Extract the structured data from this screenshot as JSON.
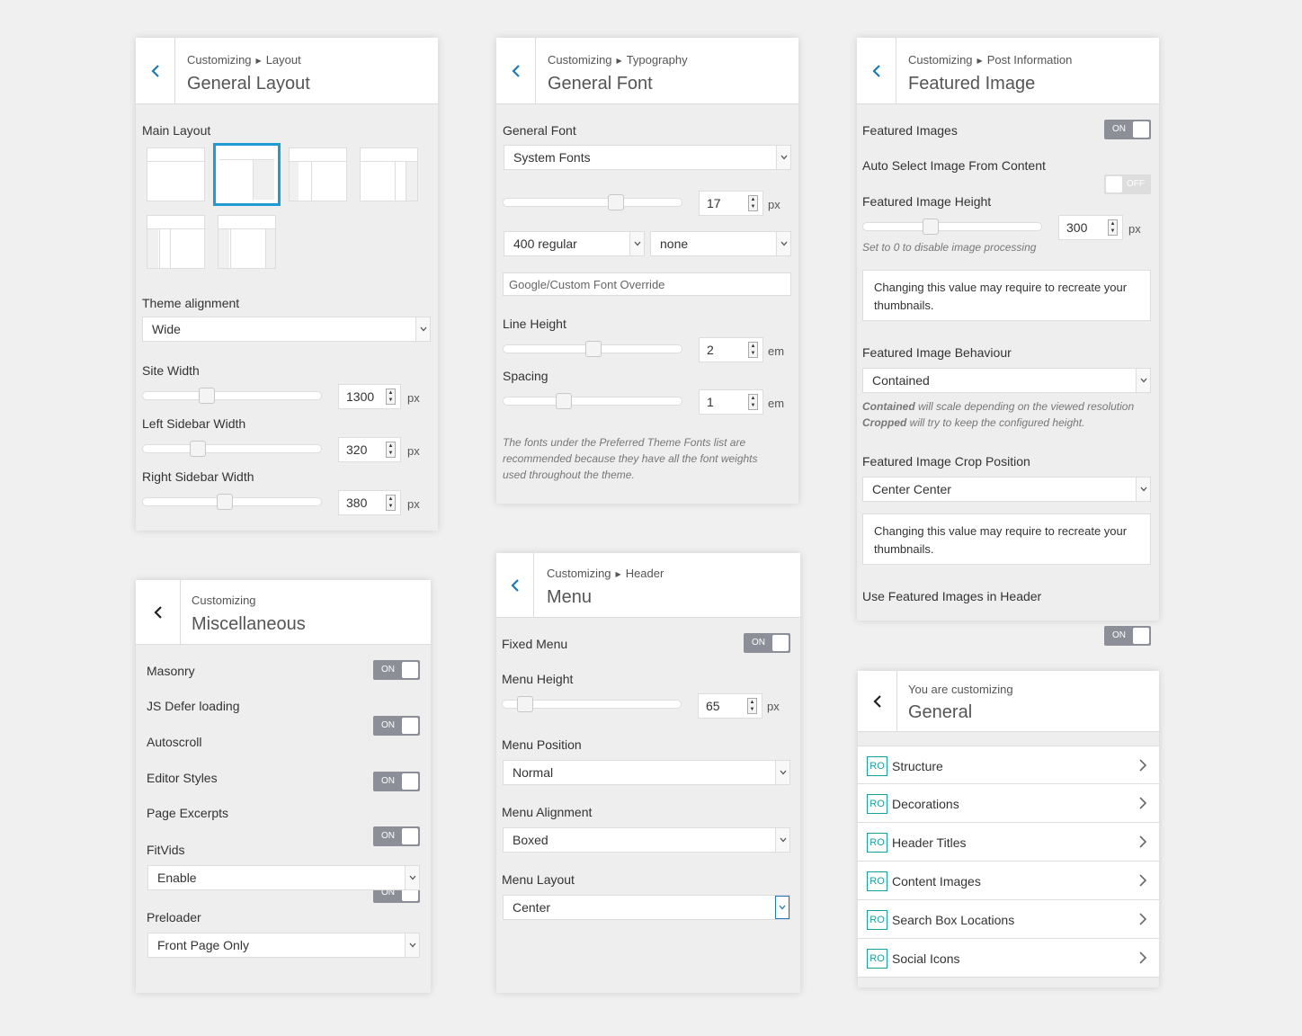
{
  "layout_panel": {
    "crumb_root": "Customizing",
    "crumb_section": "Layout",
    "title": "General Layout",
    "main_layout_label": "Main Layout",
    "theme_alignment_label": "Theme alignment",
    "theme_alignment_value": "Wide",
    "site_width_label": "Site Width",
    "site_width_value": "1300",
    "left_sidebar_label": "Left Sidebar Width",
    "left_sidebar_value": "320",
    "right_sidebar_label": "Right Sidebar Width",
    "right_sidebar_value": "380",
    "unit": "px"
  },
  "typography_panel": {
    "crumb_root": "Customizing",
    "crumb_section": "Typography",
    "title": "General Font",
    "general_font_label": "General Font",
    "general_font_value": "System Fonts",
    "font_size_value": "17",
    "font_size_unit": "px",
    "weight_value": "400 regular",
    "transform_value": "none",
    "override_placeholder": "Google/Custom Font Override",
    "line_height_label": "Line Height",
    "line_height_value": "2",
    "spacing_label": "Spacing",
    "spacing_value": "1",
    "em_unit": "em",
    "note": "The fonts under the Preferred Theme Fonts list are recommended because they have all the font weights used throughout the theme."
  },
  "featured_panel": {
    "crumb_root": "Customizing",
    "crumb_section": "Post Information",
    "title": "Featured Image",
    "featured_images_label": "Featured Images",
    "auto_select_label": "Auto Select Image From Content",
    "height_label": "Featured Image Height",
    "height_value": "300",
    "height_unit": "px",
    "height_note": "Set to 0 to disable image processing",
    "recreate_note_1": "Changing this value may require to recreate your thumbnails.",
    "behaviour_label": "Featured Image Behaviour",
    "behaviour_value": "Contained",
    "behaviour_note_b1": "Contained",
    "behaviour_note_t1": " will scale depending on the viewed resolution",
    "behaviour_note_b2": "Cropped",
    "behaviour_note_t2": " will try to keep the configured height.",
    "crop_label": "Featured Image Crop Position",
    "crop_value": "Center Center",
    "recreate_note_2": "Changing this value may require to recreate your thumbnails.",
    "use_in_header_label": "Use Featured Images in Header"
  },
  "misc_panel": {
    "crumb_root": "Customizing",
    "title": "Miscellaneous",
    "masonry_label": "Masonry",
    "js_defer_label": "JS Defer loading",
    "autoscroll_label": "Autoscroll",
    "editor_styles_label": "Editor Styles",
    "page_excerpts_label": "Page Excerpts",
    "fitvids_label": "FitVids",
    "fitvids_value": "Enable",
    "preloader_label": "Preloader",
    "preloader_value": "Front Page Only"
  },
  "menu_panel": {
    "crumb_root": "Customizing",
    "crumb_section": "Header",
    "title": "Menu",
    "fixed_menu_label": "Fixed Menu",
    "menu_height_label": "Menu Height",
    "menu_height_value": "65",
    "menu_height_unit": "px",
    "position_label": "Menu Position",
    "position_value": "Normal",
    "alignment_label": "Menu Alignment",
    "alignment_value": "Boxed",
    "layout_label": "Menu Layout",
    "layout_value": "Center"
  },
  "general_panel": {
    "crumb_root": "You are customizing",
    "title": "General",
    "ro_badge": "RO",
    "items": [
      "Structure",
      "Decorations",
      "Header Titles",
      "Content Images",
      "Search Box Locations",
      "Social Icons"
    ]
  },
  "toggles": {
    "on": "ON",
    "off": "OFF"
  },
  "colors": {
    "accent": "#1e9bd0",
    "toggle_on": "#8d8f98",
    "badge": "#17a0a0",
    "back_arrow": "#1e79b4"
  },
  "icons": {
    "back": "chevron-left-icon",
    "breadcrumb_sep": "triangle-right-icon",
    "dropdown": "chevron-down-icon",
    "item": "chevron-right-icon"
  }
}
